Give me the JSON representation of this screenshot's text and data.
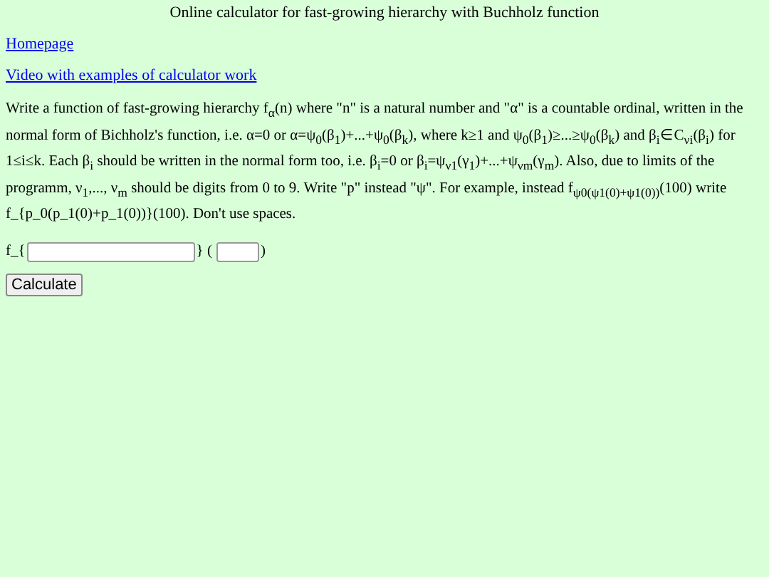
{
  "title": "Online calculator for fast-growing hierarchy with Buchholz function",
  "links": [
    "Homepage",
    "Video with examples of calculator work"
  ],
  "instructions": "Write a function of fast-growing hierarchy f$_{α}$(n) where \"n\" is a natural number and \"α\" is a countable ordinal, written in the normal form of Bichholz's function, i.e. α=0 or α=ψ$_{0}$(β$_{1}$)+...+ψ$_{0}$(β$_{k}$), where k≥1 and ψ$_{0}$(β$_{1}$)≥...≥ψ$_{0}$(β$_{k}$) and β$_{i}$∈C$_{νi}$(β$_{i}$) for 1≤i≤k. Each β$_{i}$ should be written in the normal form too, i.e. β$_{i}$=0 or β$_{i}$=ψ$_{ν1}$(γ$_{1}$)+...+ψ$_{νm}$(γ$_{m}$). Also, due to limits of the programm, ν$_{1}$,..., ν$_{m}$ should be digits from 0 to 9. Write \"p\" instead \"ψ\". For example, instead f$_{ψ0(ψ1(0)+ψ1(0))}$(100) write f_{p_0(p_1(0)+p_1(0))}(100). Don't use spaces.",
  "form": {
    "prefix": "f_{",
    "middle": "} (",
    "suffix": ")"
  },
  "button": "Calculate"
}
